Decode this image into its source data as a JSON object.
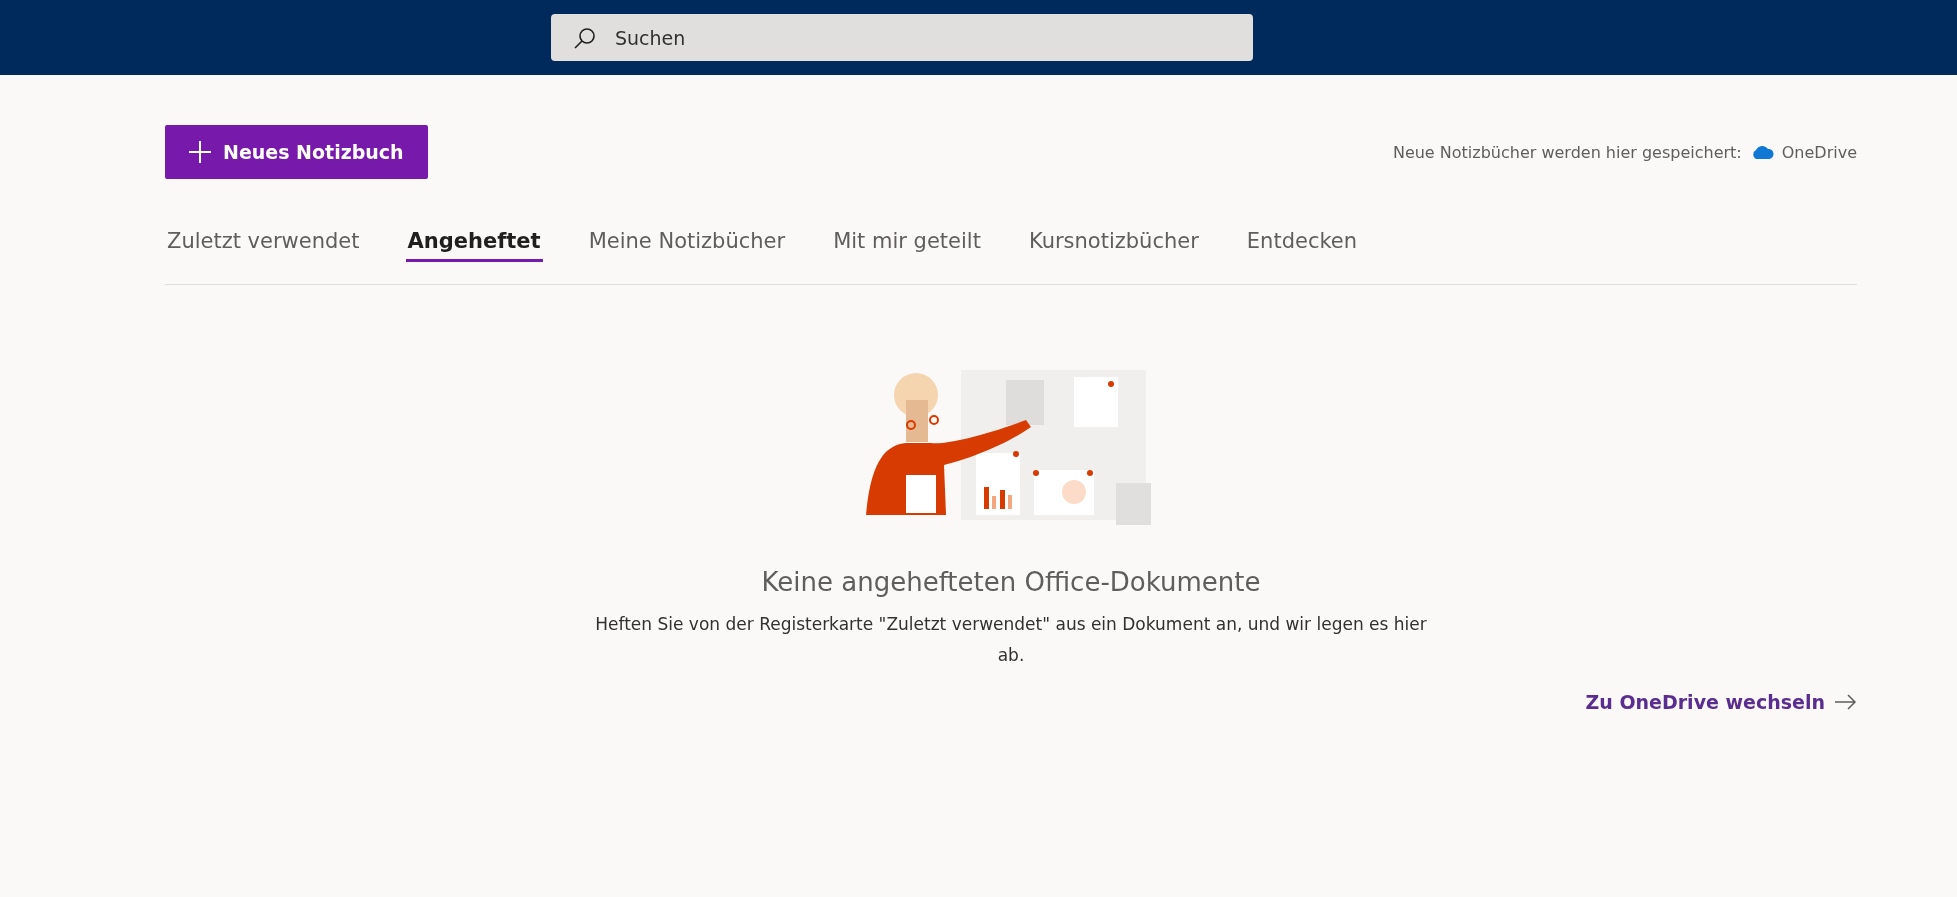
{
  "search": {
    "placeholder": "Suchen"
  },
  "new_button": {
    "label": "Neues Notizbuch"
  },
  "save_location": {
    "text": "Neue Notizbücher werden hier gespeichert:",
    "service": "OneDrive"
  },
  "tabs": [
    {
      "label": "Zuletzt verwendet",
      "selected": false
    },
    {
      "label": "Angeheftet",
      "selected": true
    },
    {
      "label": "Meine Notizbücher",
      "selected": false
    },
    {
      "label": "Mit mir geteilt",
      "selected": false
    },
    {
      "label": "Kursnotizbücher",
      "selected": false
    },
    {
      "label": "Entdecken",
      "selected": false
    }
  ],
  "empty_state": {
    "title": "Keine angehefteten Office-Dokumente",
    "description": "Heften Sie von der Registerkarte \"Zuletzt verwendet\" aus ein Dokument an, und wir legen es hier ab."
  },
  "link": {
    "label": "Zu OneDrive wechseln"
  }
}
